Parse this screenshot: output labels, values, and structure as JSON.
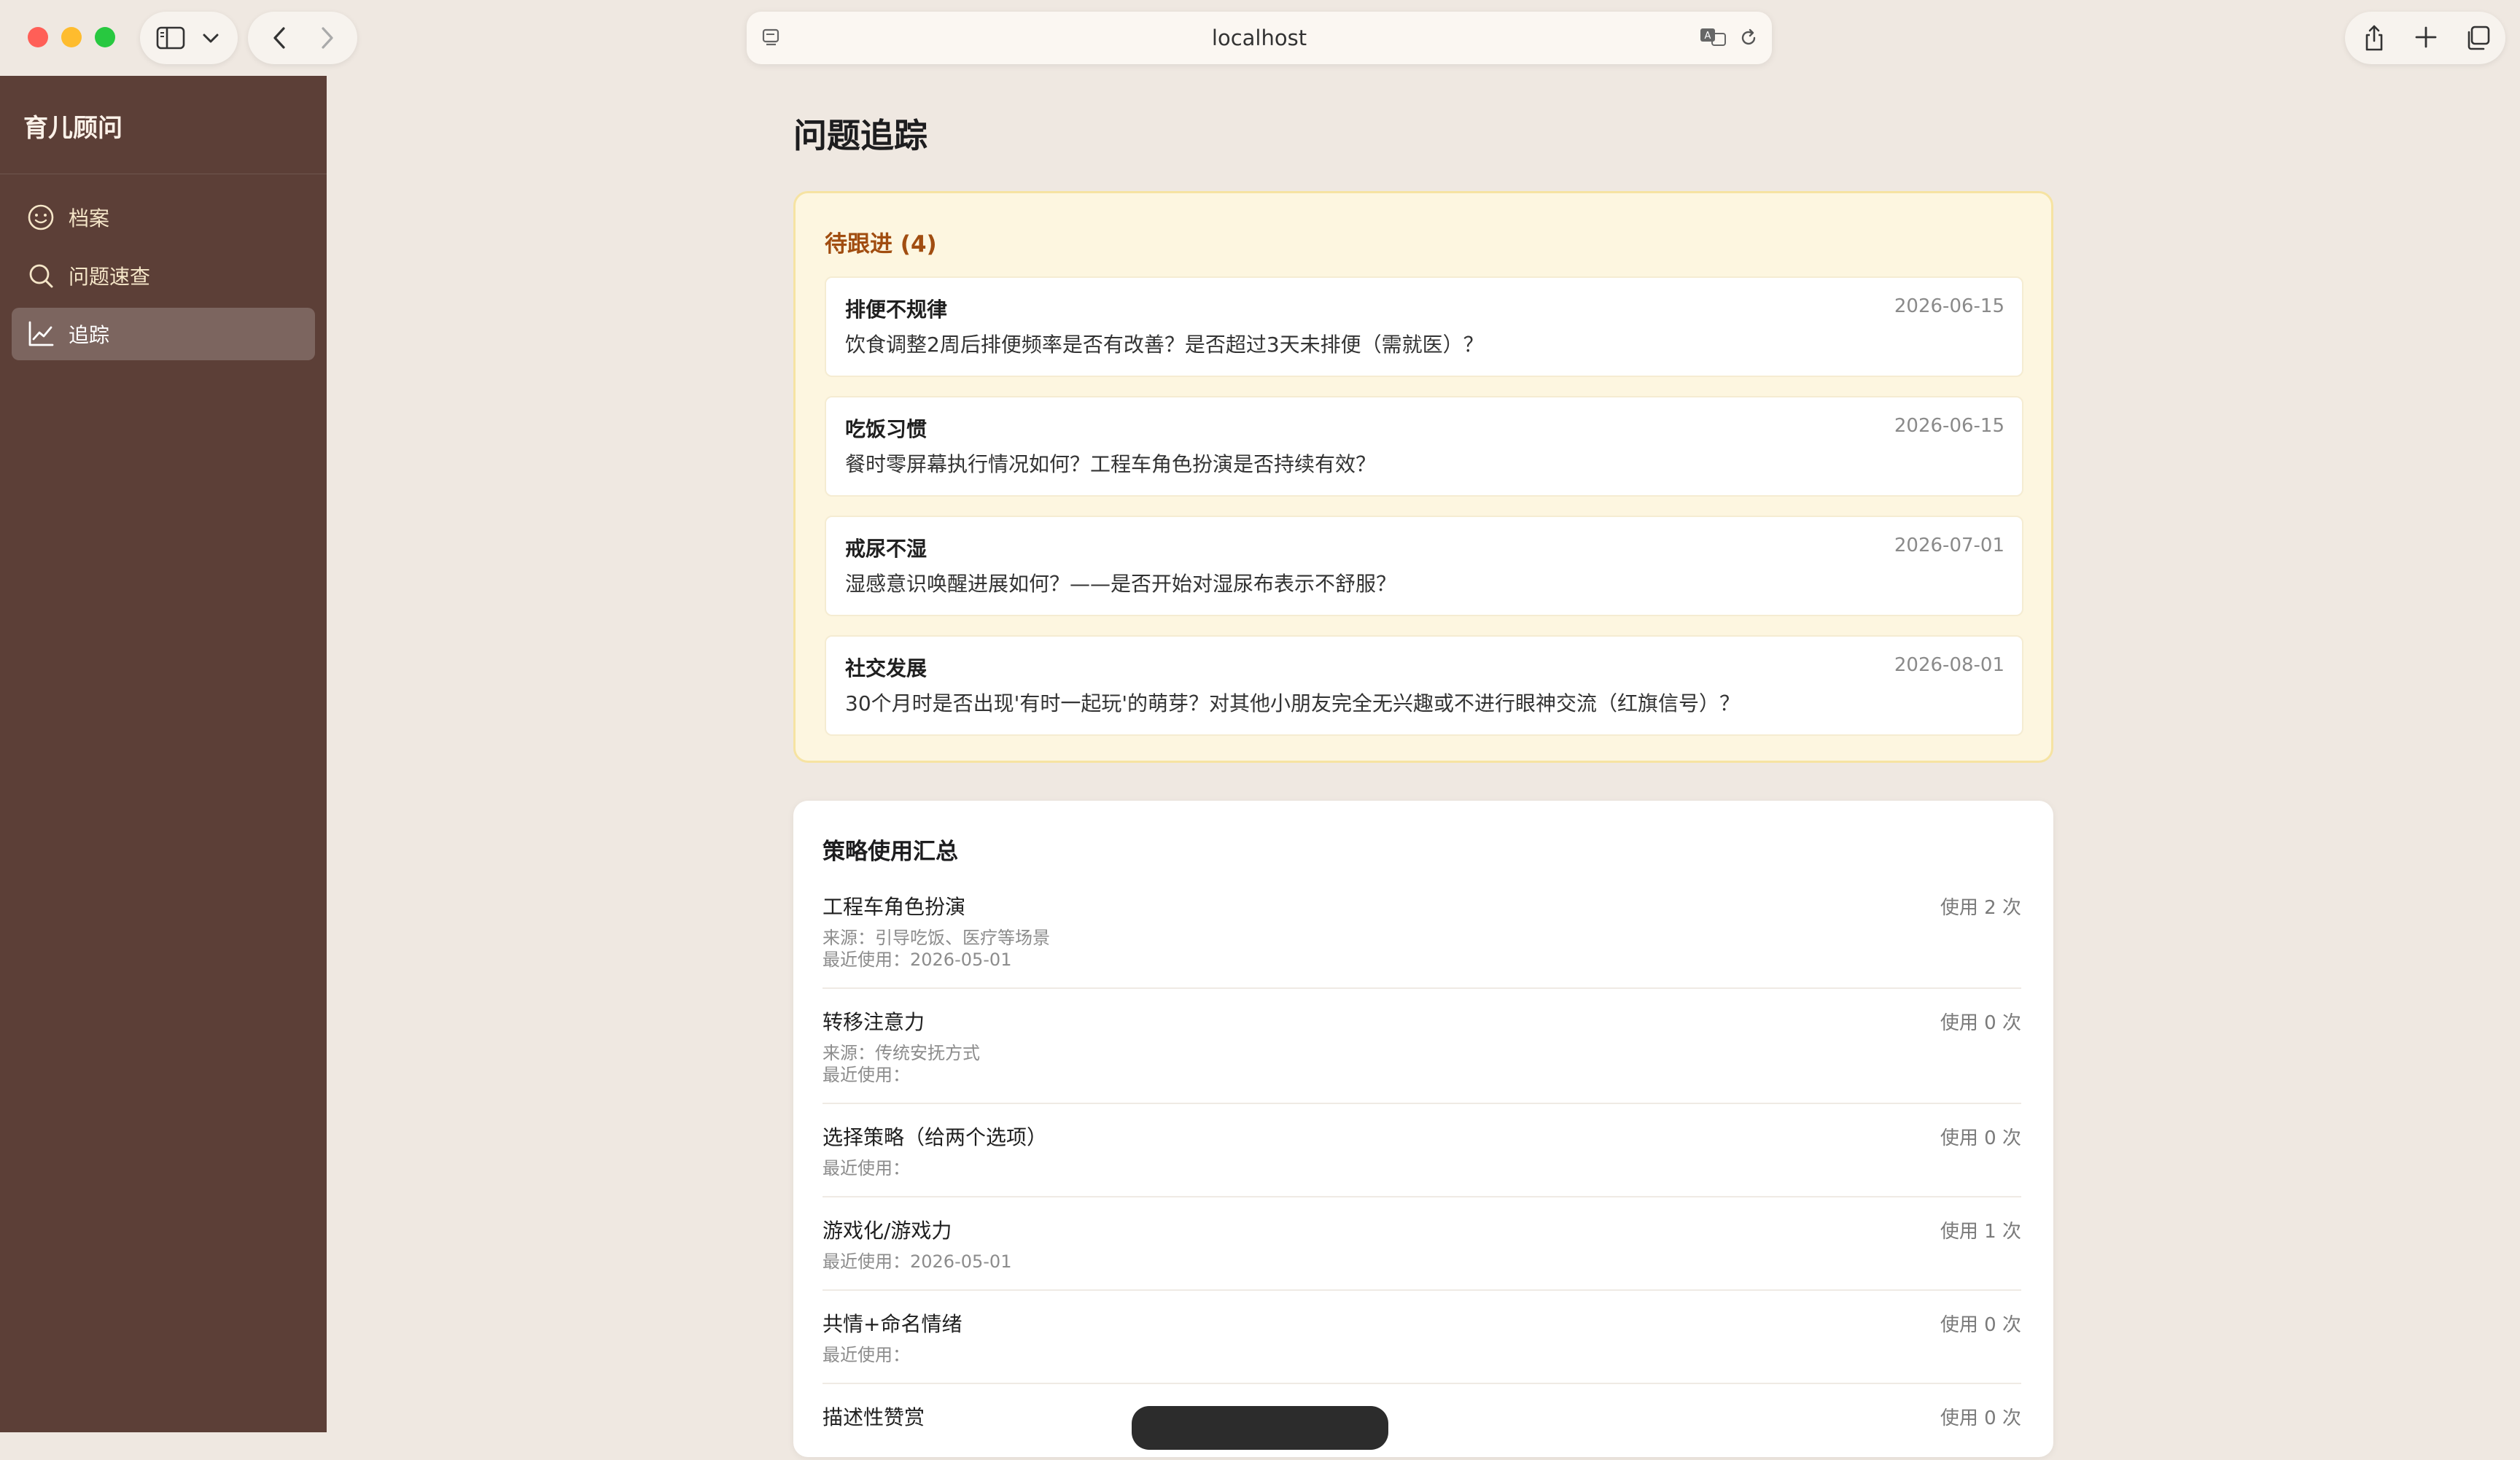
{
  "browser": {
    "url": "localhost"
  },
  "sidebar": {
    "app_title": "育儿顾问",
    "items": [
      {
        "label": "档案",
        "icon": "smiley-icon",
        "active": false
      },
      {
        "label": "问题速查",
        "icon": "search-icon",
        "active": false
      },
      {
        "label": "追踪",
        "icon": "line-chart-icon",
        "active": true
      }
    ]
  },
  "main": {
    "page_title": "问题追踪",
    "followups": {
      "heading": "待跟进 (4)",
      "items": [
        {
          "title": "排便不规律",
          "date": "2026-06-15",
          "desc": "饮食调整2周后排便频率是否有改善？是否超过3天未排便（需就医）？"
        },
        {
          "title": "吃饭习惯",
          "date": "2026-06-15",
          "desc": "餐时零屏幕执行情况如何？工程车角色扮演是否持续有效？"
        },
        {
          "title": "戒尿不湿",
          "date": "2026-07-01",
          "desc": "湿感意识唤醒进展如何？——是否开始对湿尿布表示不舒服？"
        },
        {
          "title": "社交发展",
          "date": "2026-08-01",
          "desc": "30个月时是否出现'有时一起玩'的萌芽？对其他小朋友完全无兴趣或不进行眼神交流（红旗信号）？"
        }
      ]
    },
    "strategies": {
      "heading": "策略使用汇总",
      "items": [
        {
          "name": "工程车角色扮演",
          "count": "使用 2 次",
          "source": "来源：引导吃饭、医疗等场景",
          "last_used": "最近使用：2026-05-01"
        },
        {
          "name": "转移注意力",
          "count": "使用 0 次",
          "source": "来源：传统安抚方式",
          "last_used": "最近使用："
        },
        {
          "name": "选择策略（给两个选项）",
          "count": "使用 0 次",
          "source": "",
          "last_used": "最近使用："
        },
        {
          "name": "游戏化/游戏力",
          "count": "使用 1 次",
          "source": "",
          "last_used": "最近使用：2026-05-01"
        },
        {
          "name": "共情+命名情绪",
          "count": "使用 0 次",
          "source": "",
          "last_used": "最近使用："
        },
        {
          "name": "描述性赞赏",
          "count": "使用 0 次",
          "source": "",
          "last_used": ""
        }
      ]
    }
  }
}
